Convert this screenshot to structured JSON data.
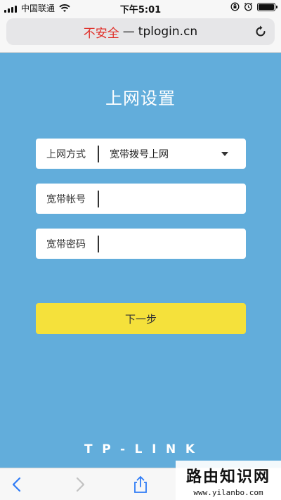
{
  "status_bar": {
    "carrier": "中国联通",
    "time": "下午5:01"
  },
  "url_bar": {
    "insecure_label": "不安全",
    "separator": "—",
    "domain": "tplogin.cn"
  },
  "page": {
    "title": "上网设置"
  },
  "form": {
    "connection_type": {
      "label": "上网方式",
      "value": "宽带拨号上网"
    },
    "account": {
      "label": "宽带帐号",
      "value": ""
    },
    "password": {
      "label": "宽带密码",
      "value": ""
    },
    "next_button_label": "下一步"
  },
  "brand": {
    "logo_text": "TP-LINK"
  },
  "watermark": {
    "title": "路由知识网",
    "url": "www.yilanbo.com"
  },
  "colors": {
    "background": "#62addb",
    "button": "#f5e13b",
    "insecure": "#e0302a"
  },
  "icons": {
    "reload": "reload-icon",
    "back": "back-arrow-icon",
    "forward": "forward-arrow-icon",
    "share": "share-icon"
  }
}
